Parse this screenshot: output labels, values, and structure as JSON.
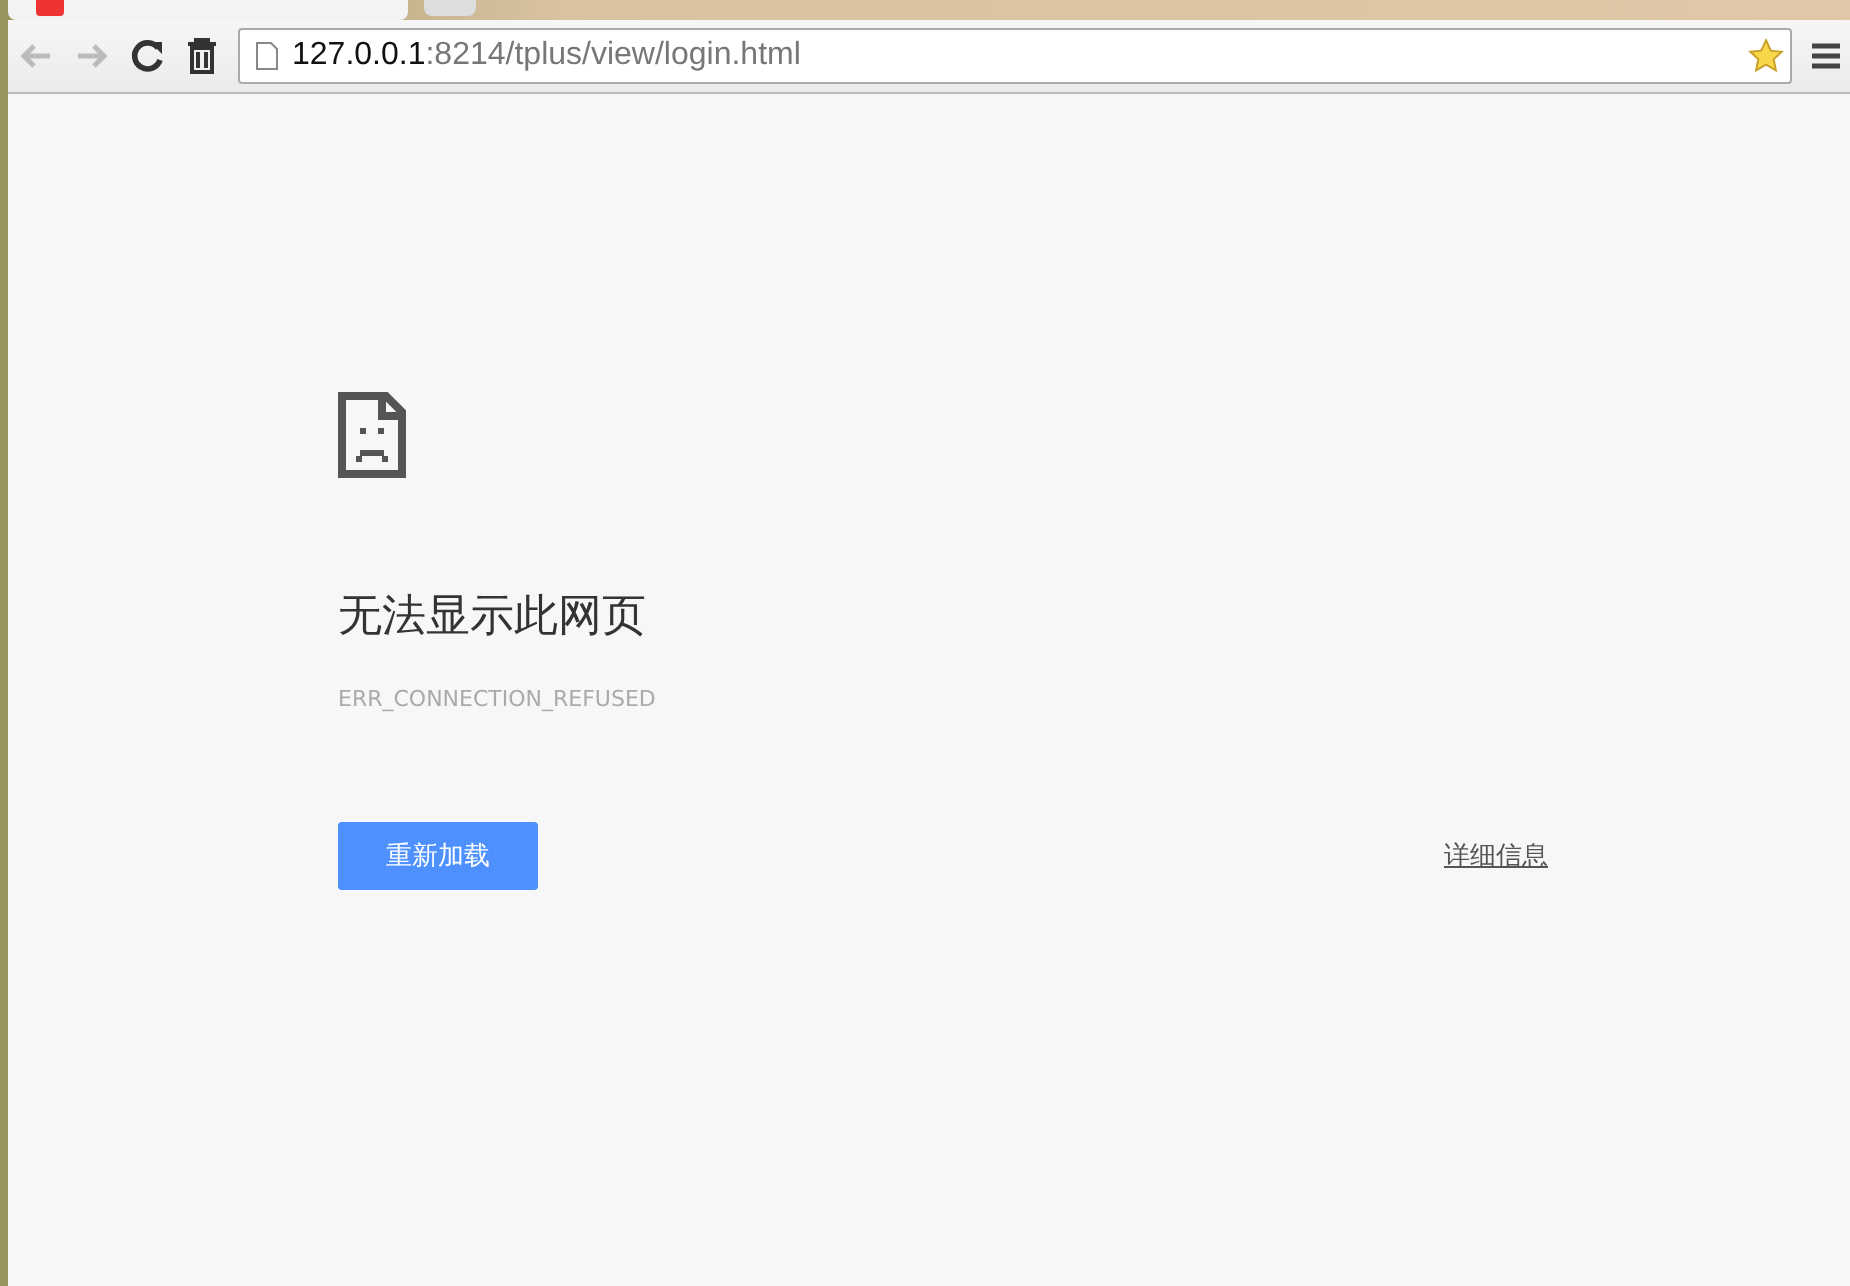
{
  "address_bar": {
    "host": "127.0.0.1",
    "path": ":8214/tplus/view/login.html"
  },
  "error": {
    "title": "无法显示此网页",
    "code": "ERR_CONNECTION_REFUSED"
  },
  "buttons": {
    "reload": "重新加载",
    "details": "详细信息"
  }
}
